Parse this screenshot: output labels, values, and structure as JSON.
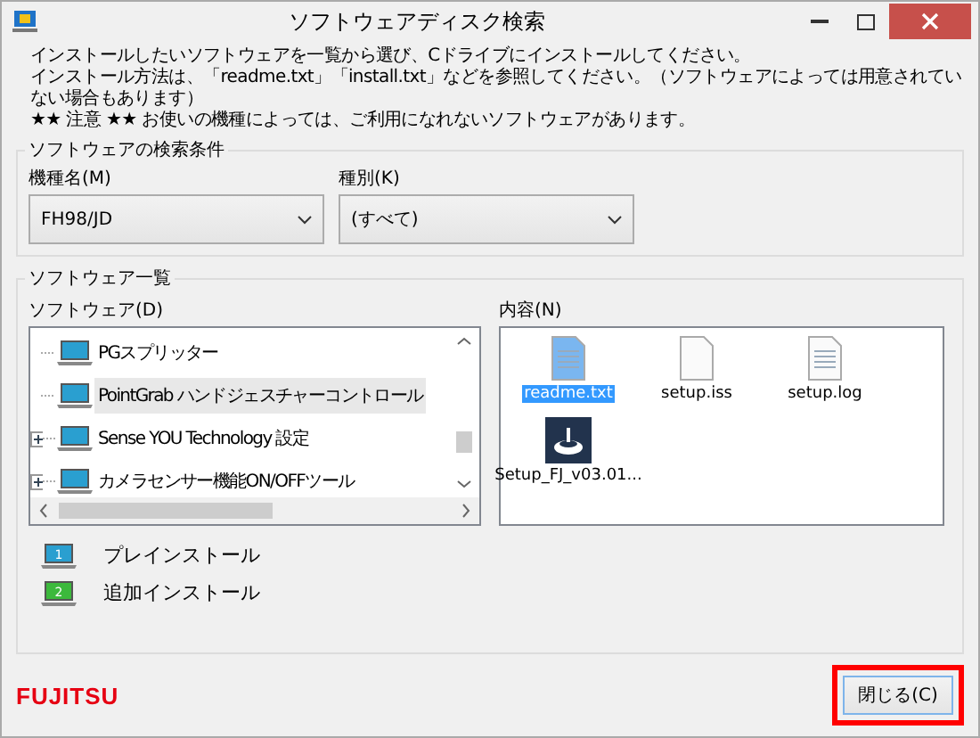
{
  "window": {
    "title": "ソフトウェアディスク検索"
  },
  "instructions": [
    "インストールしたいソフトウェアを一覧から選び、Cドライブにインストールしてください。",
    "インストール方法は、「readme.txt」「install.txt」などを参照してください。（ソフトウェアによっては用意されていない場合もあります）",
    "★★ 注意 ★★ お使いの機種によっては、ご利用になれないソフトウェアがあります。"
  ],
  "search_conditions": {
    "title": "ソフトウェアの検索条件",
    "model": {
      "label": "機種名(M)",
      "value": "FH98/JD"
    },
    "type": {
      "label": "種別(K)",
      "value": "(すべて)"
    }
  },
  "software_list": {
    "title": "ソフトウェア一覧",
    "tree_label": "ソフトウェア(D)",
    "tree": [
      {
        "label": "PGスプリッター",
        "expandable": false,
        "selected": false
      },
      {
        "label": "PointGrab ハンドジェスチャーコントロール",
        "expandable": false,
        "selected": true
      },
      {
        "label": "Sense YOU Technology 設定",
        "expandable": true,
        "selected": false
      },
      {
        "label": "カメラセンサー機能ON/OFFツール",
        "expandable": true,
        "selected": false
      }
    ],
    "contents_label": "内容(N)",
    "files": [
      {
        "name": "readme.txt",
        "kind": "text",
        "selected": true
      },
      {
        "name": "setup.iss",
        "kind": "blank",
        "selected": false
      },
      {
        "name": "setup.log",
        "kind": "log",
        "selected": false
      },
      {
        "name": "Setup_FJ_v03.01...",
        "kind": "setup",
        "selected": false
      }
    ],
    "legend": [
      {
        "number": "1",
        "label": "プレインストール",
        "color": "#2a9fd0"
      },
      {
        "number": "2",
        "label": "追加インストール",
        "color": "#3cb93c"
      }
    ]
  },
  "footer": {
    "logo": "FUJITSU",
    "close_button": "閉じる(C)",
    "highlighted": true
  }
}
